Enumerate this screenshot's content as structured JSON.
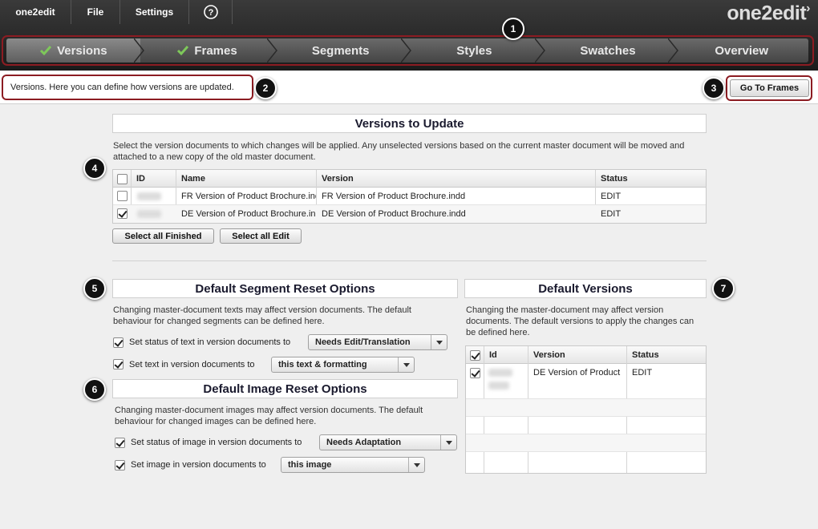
{
  "menu": {
    "app": "one2edit",
    "file": "File",
    "settings": "Settings",
    "help": "?"
  },
  "brand": {
    "name": "one2edit",
    "mark": "›"
  },
  "steps": [
    "Versions",
    "Frames",
    "Segments",
    "Styles",
    "Swatches",
    "Overview"
  ],
  "steps_completed": [
    "Versions",
    "Frames"
  ],
  "steps_active": "Versions",
  "info": {
    "text": "Versions. Here you can define how versions are updated."
  },
  "goto_button": "Go To Frames",
  "callouts": [
    "1",
    "2",
    "3",
    "4",
    "5",
    "6",
    "7"
  ],
  "versions_to_update": {
    "title": "Versions to Update",
    "description": "Select the version documents to which changes will be applied. Any unselected versions based on the current master document will be moved and attached to a new copy of the old master document.",
    "columns": [
      "ID",
      "Name",
      "Version",
      "Status"
    ],
    "rows": [
      {
        "checked": false,
        "name": "FR Version of Product Brochure.indd",
        "version": "FR Version of Product Brochure.indd",
        "status": "EDIT"
      },
      {
        "checked": true,
        "name": "DE Version of Product Brochure.indd",
        "version": "DE Version of Product Brochure.indd",
        "status": "EDIT"
      }
    ],
    "select_finished": "Select all Finished",
    "select_edit": "Select all Edit"
  },
  "segment_reset": {
    "title": "Default Segment Reset Options",
    "description": "Changing master-document texts may affect version documents. The default behaviour for changed segments can be defined here.",
    "options": [
      {
        "label": "Set status of text in version documents to",
        "value": "Needs Edit/Translation",
        "checked": true
      },
      {
        "label": "Set text in version documents to",
        "value": "this text & formatting",
        "checked": true
      }
    ]
  },
  "image_reset": {
    "title": "Default Image Reset Options",
    "description": "Changing master-document images may affect version documents. The default behaviour for changed images can be defined here.",
    "options": [
      {
        "label": "Set status of image in version documents to",
        "value": "Needs Adaptation",
        "checked": true
      },
      {
        "label": "Set image in version documents to",
        "value": "this image",
        "checked": true
      }
    ]
  },
  "default_versions": {
    "title": "Default Versions",
    "description": "Changing the master-document may affect version documents. The default versions to apply the changes can be defined here.",
    "columns": [
      "Id",
      "Version",
      "Status"
    ],
    "rows": [
      {
        "checked": true,
        "version": "DE Version of Product",
        "status": "EDIT"
      }
    ]
  }
}
